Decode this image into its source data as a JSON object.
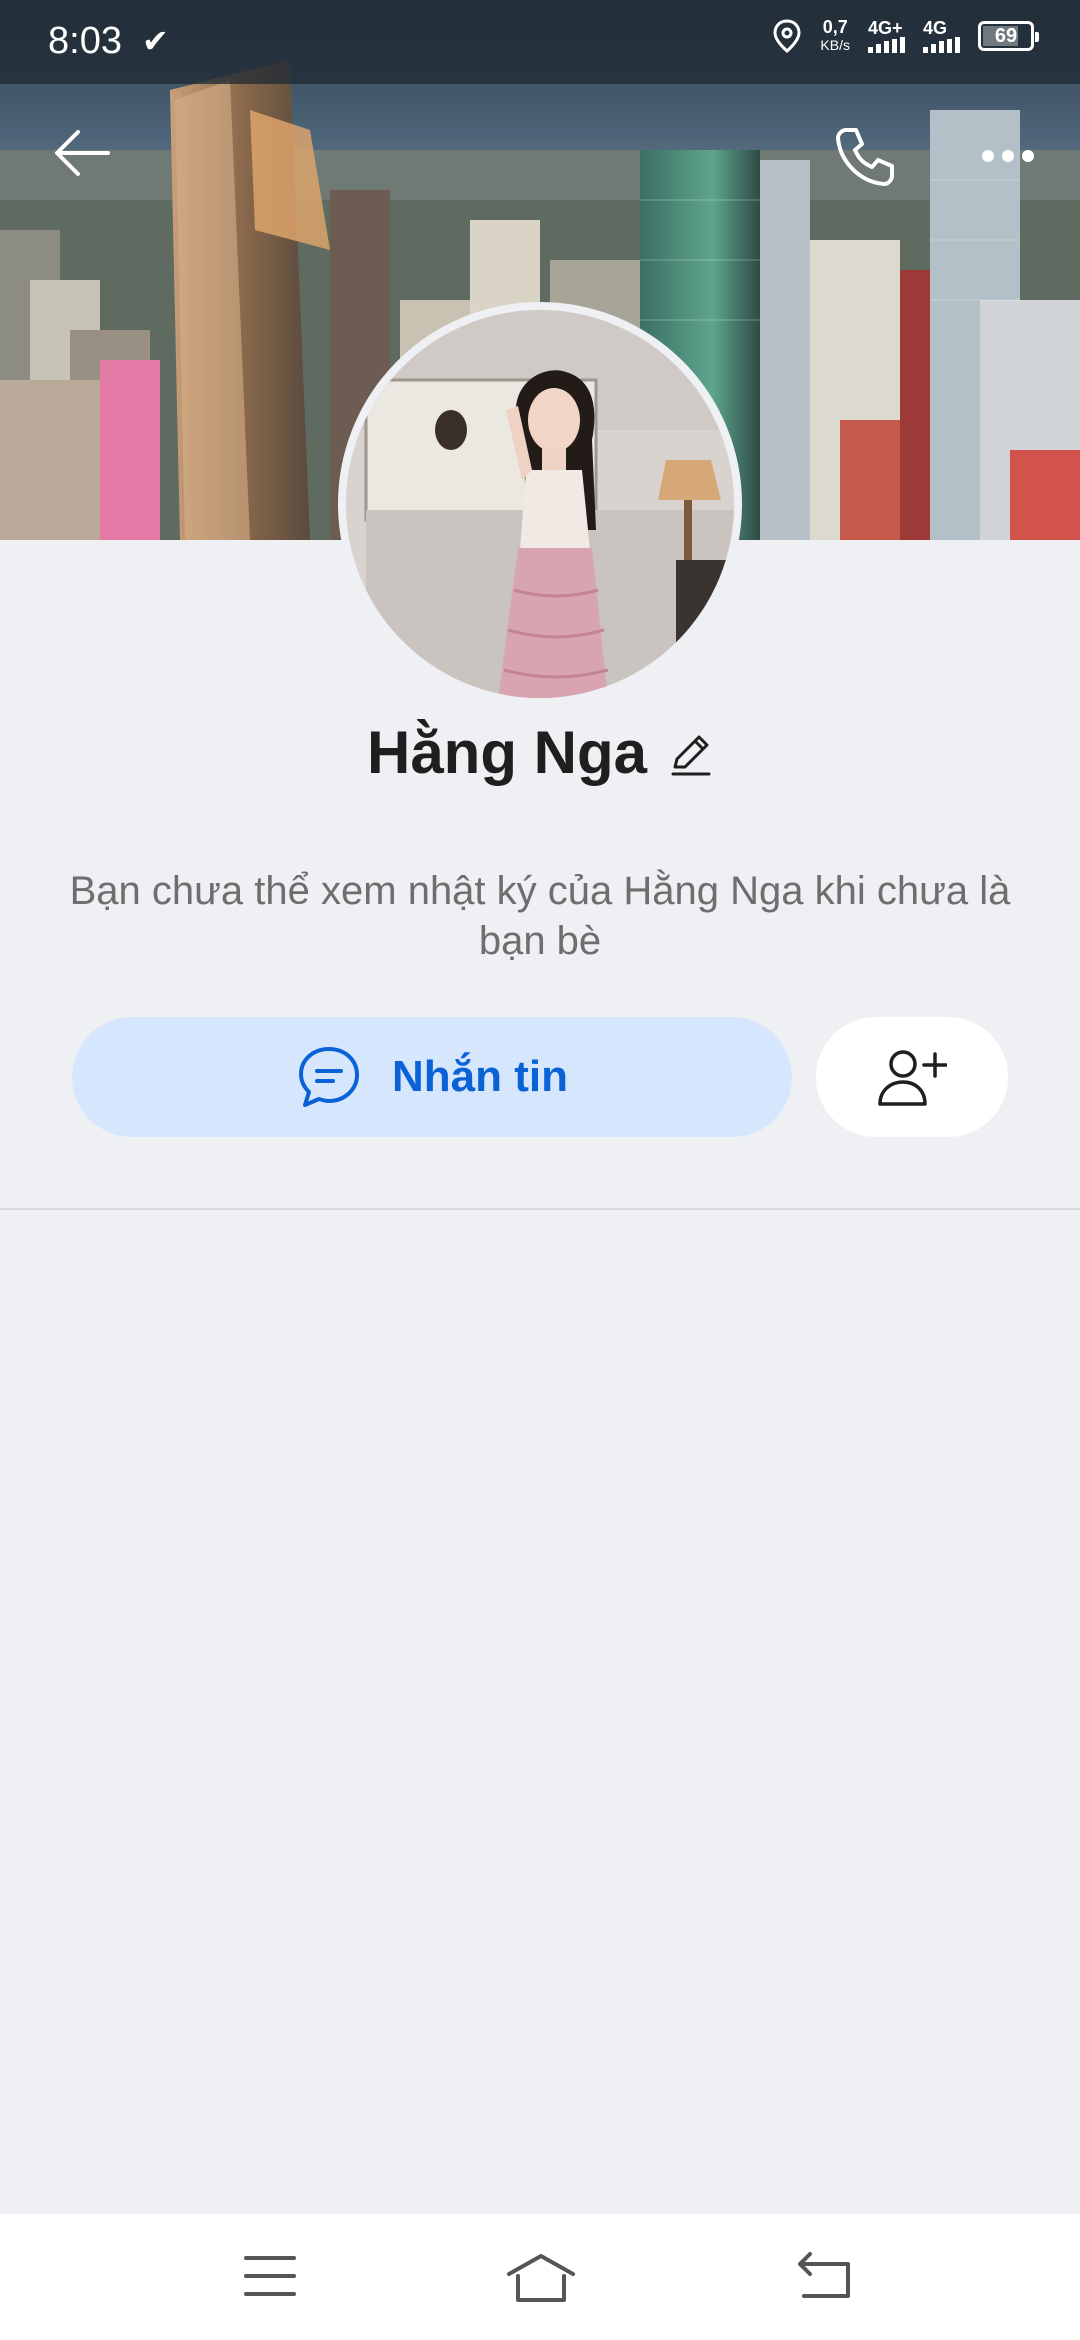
{
  "status_bar": {
    "time": "8:03",
    "net_speed_value": "0,7",
    "net_speed_unit": "KB/s",
    "network_1": "4G+",
    "network_2": "4G",
    "battery": "69"
  },
  "profile": {
    "name": "Hằng Nga",
    "info_text": "Bạn chưa thể xem nhật ký của Hằng Nga khi chưa là bạn bè"
  },
  "actions": {
    "message_label": "Nhắn tin"
  },
  "icons": {
    "back": "arrow-left-icon",
    "call": "phone-icon",
    "more": "more-horizontal-icon",
    "edit": "pencil-icon",
    "message": "chat-bubble-icon",
    "add_friend": "add-user-icon",
    "nav_menu": "menu-icon",
    "nav_home": "home-icon",
    "nav_back": "back-icon"
  },
  "colors": {
    "accent": "#0a62d6",
    "message_button_bg": "#d6e7fd",
    "page_bg": "#eff0f4"
  }
}
